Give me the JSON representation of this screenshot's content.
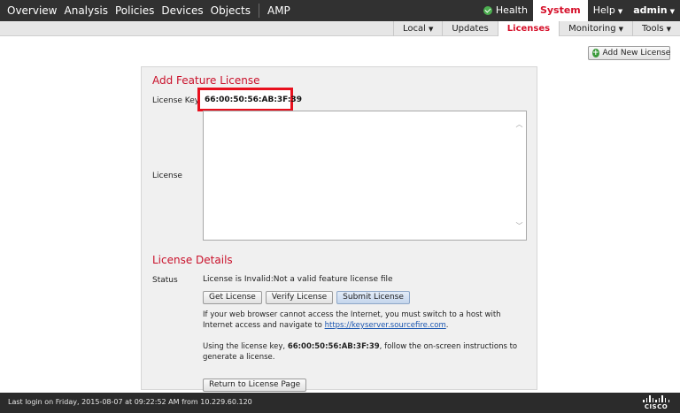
{
  "topnav": {
    "items": [
      "Overview",
      "Analysis",
      "Policies",
      "Devices",
      "Objects",
      "AMP"
    ],
    "health_label": "Health",
    "system_label": "System",
    "help_label": "Help",
    "admin_label": "admin"
  },
  "subnav": {
    "items": [
      "Local",
      "Updates",
      "Licenses",
      "Monitoring",
      "Tools"
    ],
    "active": "Licenses"
  },
  "toolbar": {
    "add_license_label": "Add New License"
  },
  "feature_license": {
    "title": "Add Feature License",
    "key_label": "License Key",
    "key_value": "66:00:50:56:AB:3F:39",
    "license_label": "License",
    "license_value": ""
  },
  "details": {
    "title": "License Details",
    "status_label": "Status",
    "status_value": "License is Invalid:Not a valid feature license file",
    "buttons": {
      "get": "Get License",
      "verify": "Verify License",
      "submit": "Submit License",
      "return": "Return to License Page"
    },
    "para1_part1": "If your web browser cannot access the Internet, you must switch to a host with Internet access and navigate to ",
    "para1_link": "https://keyserver.sourcefire.com",
    "para1_part2": ".",
    "para2_part1": "Using the license key, ",
    "para2_key": "66:00:50:56:AB:3F:39",
    "para2_part2": ", follow the on-screen instructions to generate a license."
  },
  "footer": {
    "last_login": "Last login on Friday, 2015-08-07 at 09:22:52 AM from 10.229.60.120",
    "logo_text": "CISCO"
  },
  "colors": {
    "accent": "#c9102a",
    "topbar": "#313131",
    "highlight_box": "#e8101e"
  }
}
